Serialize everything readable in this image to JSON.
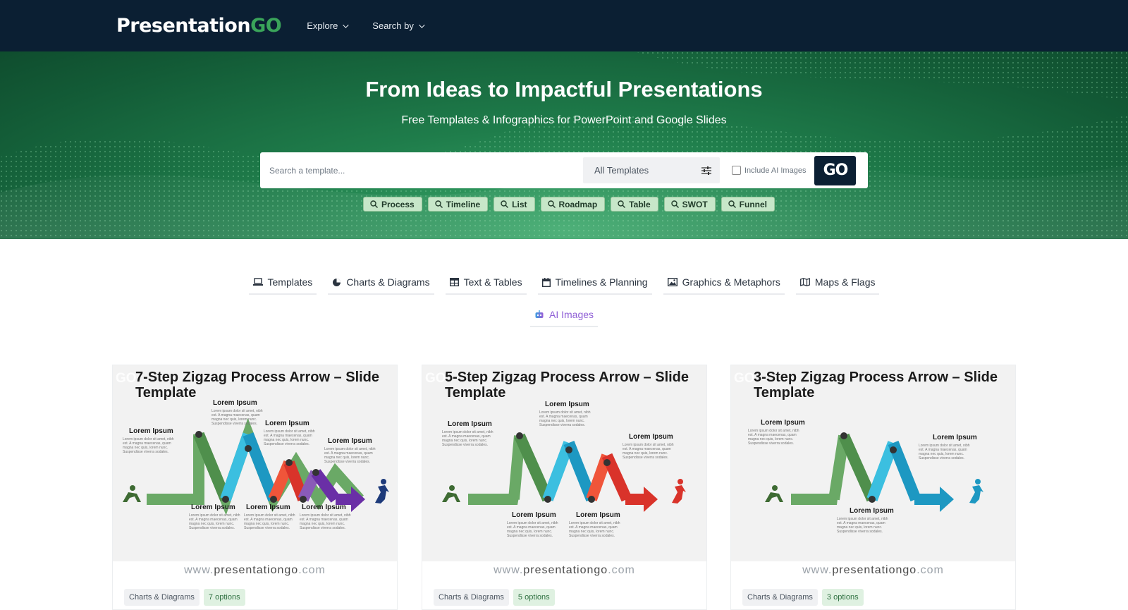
{
  "nav": {
    "logo_main": "Presentation",
    "logo_go": "GO",
    "links": [
      {
        "label": "Explore"
      },
      {
        "label": "Search by"
      }
    ]
  },
  "hero": {
    "title": "From Ideas to Impactful Presentations",
    "subtitle": "Free Templates & Infographics for PowerPoint and Google Slides",
    "search_placeholder": "Search a template...",
    "select_value": "All Templates",
    "include_ai_label": "Include AI Images",
    "include_ai_checked": false,
    "go_label": "GO",
    "chips": [
      "Process",
      "Timeline",
      "List",
      "Roadmap",
      "Table",
      "SWOT",
      "Funnel"
    ]
  },
  "categories": [
    {
      "label": "Templates",
      "icon": "laptop-icon"
    },
    {
      "label": "Charts & Diagrams",
      "icon": "pie-chart-icon"
    },
    {
      "label": "Text & Tables",
      "icon": "table-icon"
    },
    {
      "label": "Timelines & Planning",
      "icon": "calendar-icon"
    },
    {
      "label": "Graphics & Metaphors",
      "icon": "image-icon"
    },
    {
      "label": "Maps & Flags",
      "icon": "map-icon"
    },
    {
      "label": "AI Images",
      "icon": "robot-icon"
    }
  ],
  "cards": [
    {
      "title": "7-Step Zigzag Process Arrow – Slide Template",
      "category": "Charts & Diagrams",
      "options": "7 options",
      "steps": 7
    },
    {
      "title": "5-Step Zigzag Process Arrow – Slide Template",
      "category": "Charts & Diagrams",
      "options": "5 options",
      "steps": 5
    },
    {
      "title": "3-Step Zigzag Process Arrow – Slide Template",
      "category": "Charts & Diagrams",
      "options": "3 options",
      "steps": 3
    }
  ],
  "thumb_text": {
    "heading": "Lorem Ipsum",
    "body": "Lorem ipsum dolor sit amet, nibh est. A magna maecenas, quam magna nec quis, lorem nunc. Suspendisse viverra sodales.",
    "url_prefix": "www.",
    "url_main": "presentationgo",
    "url_suffix": ".com",
    "watermark": "GO"
  },
  "colors": {
    "nav_bg": "#0b1f33",
    "brand_green": "#3aa45a",
    "chip_bg": "#c7e7c9",
    "ai_purple": "#8f5fd6",
    "step_colors": [
      "#6aa966",
      "#4f8f4c",
      "#3bbfe0",
      "#1d98c2",
      "#f0553a",
      "#8a5bb8",
      "#6a2fa6"
    ]
  }
}
